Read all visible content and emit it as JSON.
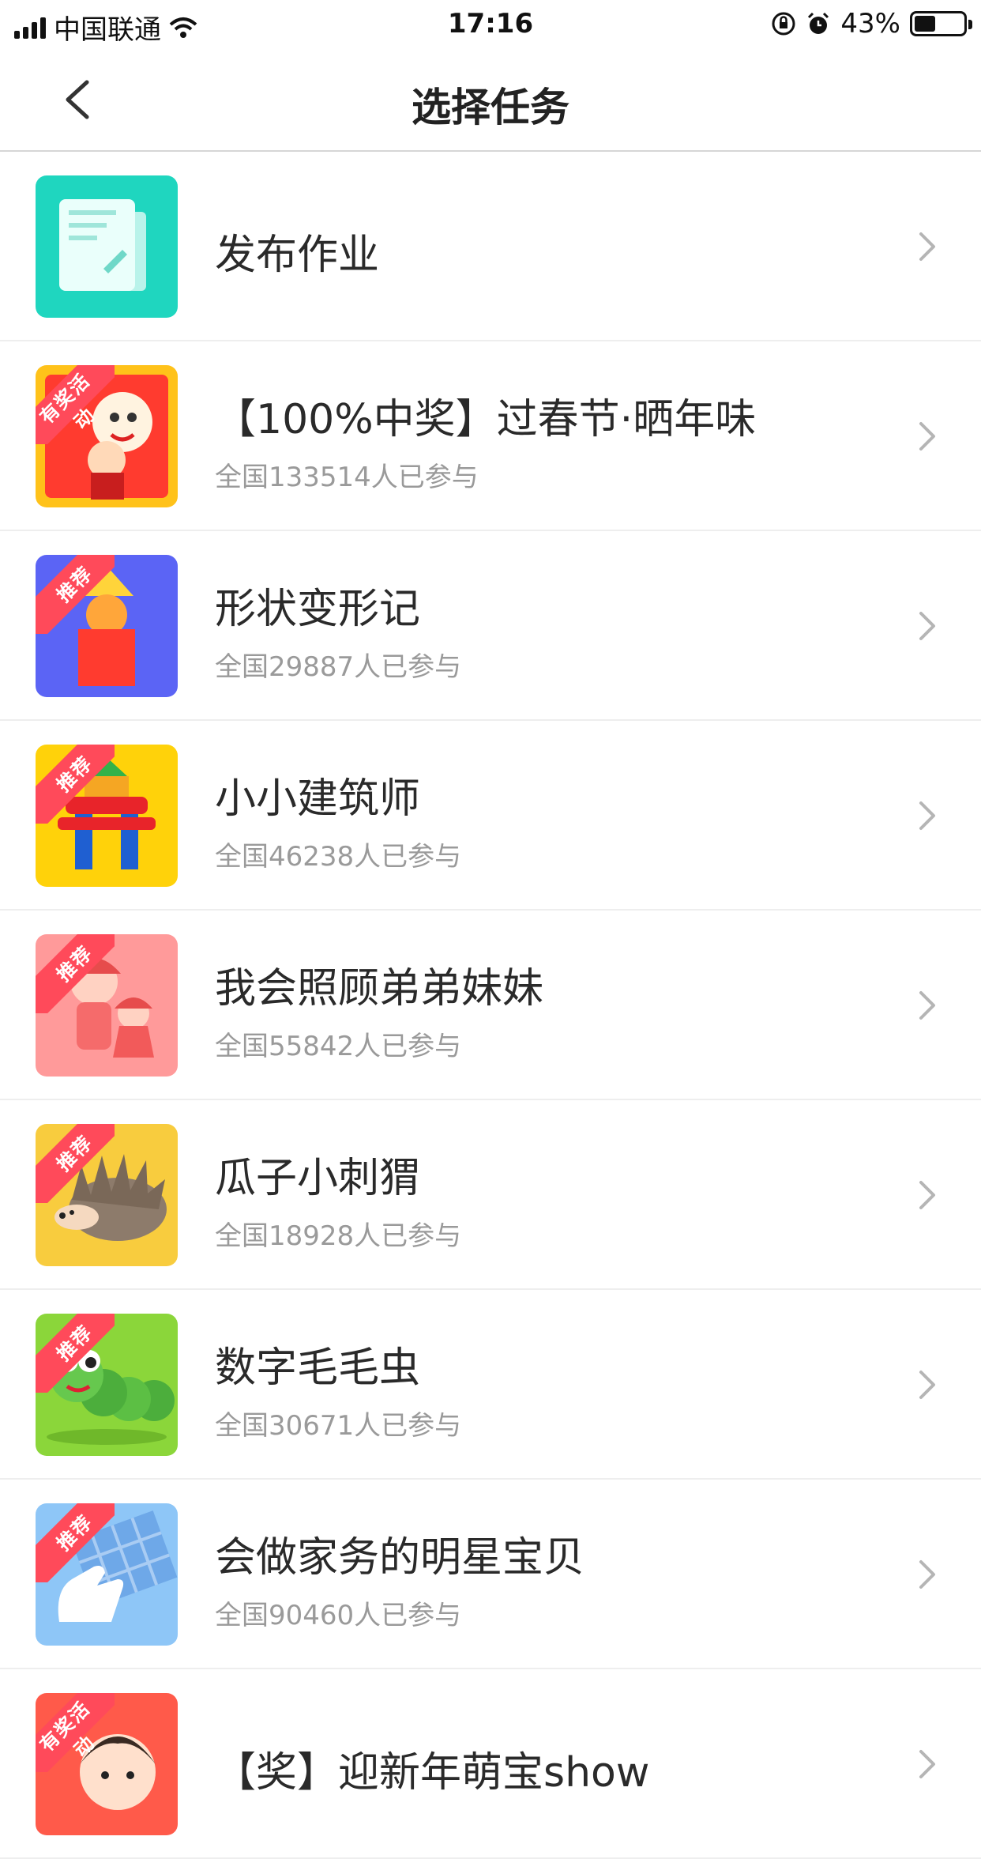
{
  "status_bar": {
    "carrier": "中国联通",
    "time": "17:16",
    "battery": "43%",
    "battery_level": 0.43
  },
  "nav": {
    "title": "选择任务"
  },
  "tasks": [
    {
      "title": "发布作业",
      "participants": "",
      "recommended": false,
      "colors": [
        "#1fd6bf"
      ],
      "icon": "assignment-icon"
    },
    {
      "title": "【100%中奖】过春节·晒年味",
      "participants": "全国133514人已参与",
      "recommended": true,
      "ribbon": "有奖活动",
      "colors": [
        "#ff3b2f",
        "#ffc21a"
      ],
      "icon": "lion-dance-icon"
    },
    {
      "title": "形状变形记",
      "participants": "全国29887人已参与",
      "recommended": true,
      "ribbon": "推荐",
      "colors": [
        "#5b64f5"
      ],
      "icon": "shapes-icon"
    },
    {
      "title": "小小建筑师",
      "participants": "全国46238人已参与",
      "recommended": true,
      "ribbon": "推荐",
      "colors": [
        "#ffd20a"
      ],
      "icon": "building-blocks-icon"
    },
    {
      "title": "我会照顾弟弟妹妹",
      "participants": "全国55842人已参与",
      "recommended": true,
      "ribbon": "推荐",
      "colors": [
        "#ff9a9a"
      ],
      "icon": "siblings-icon"
    },
    {
      "title": "瓜子小刺猬",
      "participants": "全国18928人已参与",
      "recommended": true,
      "ribbon": "推荐",
      "colors": [
        "#f8cc3e"
      ],
      "icon": "hedgehog-icon"
    },
    {
      "title": "数字毛毛虫",
      "participants": "全国30671人已参与",
      "recommended": true,
      "ribbon": "推荐",
      "colors": [
        "#8bd63a"
      ],
      "icon": "caterpillar-icon"
    },
    {
      "title": "会做家务的明星宝贝",
      "participants": "全国90460人已参与",
      "recommended": true,
      "ribbon": "推荐",
      "colors": [
        "#8ec6f7"
      ],
      "icon": "housework-icon"
    },
    {
      "title": "【奖】迎新年萌宝show",
      "participants": "",
      "recommended": true,
      "ribbon": "有奖活动",
      "colors": [
        "#ff5a4a"
      ],
      "icon": "baby-show-icon"
    }
  ]
}
